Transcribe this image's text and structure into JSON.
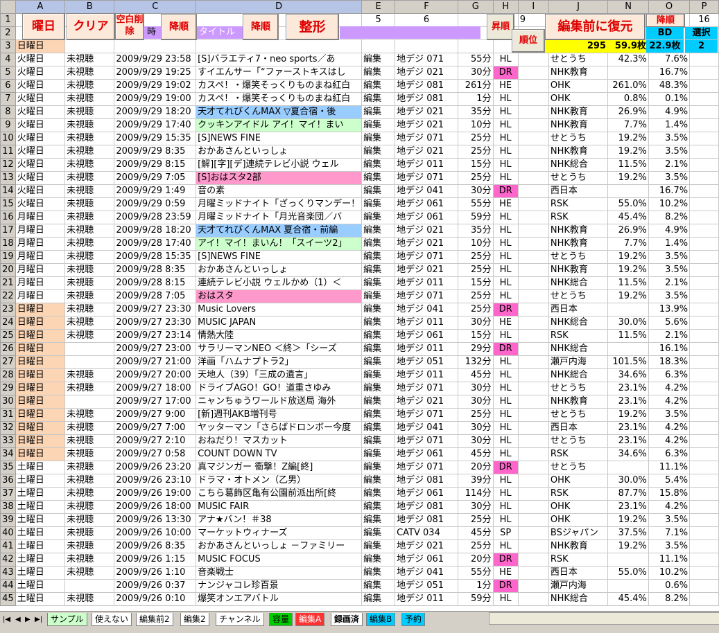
{
  "columns": [
    "A",
    "B",
    "C",
    "D",
    "E",
    "F",
    "G",
    "H",
    "I",
    "J",
    "N",
    "O",
    "P"
  ],
  "header_row1": {
    "e": "5",
    "f": "6",
    "i": "9",
    "p": "16"
  },
  "buttons": {
    "youbi": "曜日",
    "clear": "クリア",
    "blank_delete": "空白削除",
    "sort_desc_c": "降順",
    "sort_desc_d": "降順",
    "seikei": "整形",
    "shoujun": "昇順",
    "juni": "順位",
    "restore": "編集前に復元",
    "sort_desc_o": "降順"
  },
  "row2": {
    "c_label": "時",
    "d_label": "タイトル",
    "o_label": "BD",
    "p_label": "選択"
  },
  "row3": {
    "a": "日曜日",
    "n_total": "295",
    "n_pct": "59.9枚",
    "o_val": "22.9枚",
    "p_val": "2"
  },
  "rows": [
    {
      "n": "4",
      "a": "火曜日",
      "b": "未視聴",
      "c": "2009/9/29 23:58",
      "d": "[S]バラエティ7・neo sports／あ",
      "e": "編集",
      "f": "地デジ 071",
      "g": "55分",
      "h": "HL",
      "j": "せとうち",
      "n2": "42.3%",
      "o": "7.6%"
    },
    {
      "n": "5",
      "a": "火曜日",
      "b": "未視聴",
      "c": "2009/9/29 19:25",
      "d": "すイエんサー「“ファーストキスはし",
      "e": "編集",
      "f": "地デジ 021",
      "g": "30分",
      "h": "DR",
      "j": "NHK教育",
      "n2": "",
      "o": "16.7%"
    },
    {
      "n": "6",
      "a": "火曜日",
      "b": "未視聴",
      "c": "2009/9/29 19:02",
      "d": "カスペ！・爆笑そっくりものまね紅白",
      "e": "編集",
      "f": "地デジ 081",
      "g": "261分",
      "h": "HE",
      "j": "OHK",
      "n2": "261.0%",
      "o": "48.3%"
    },
    {
      "n": "7",
      "a": "火曜日",
      "b": "未視聴",
      "c": "2009/9/29 19:00",
      "d": "カスペ！・爆笑そっくりものまね紅白",
      "e": "編集",
      "f": "地デジ 081",
      "g": "1分",
      "h": "HL",
      "j": "OHK",
      "n2": "0.8%",
      "o": "0.1%"
    },
    {
      "n": "8",
      "a": "火曜日",
      "b": "未視聴",
      "c": "2009/9/29 18:20",
      "d": "天才てれびくんMAX ▽夏合宿・後",
      "e": "編集",
      "f": "地デジ 021",
      "g": "35分",
      "h": "HL",
      "j": "NHK教育",
      "n2": "26.9%",
      "o": "4.9%"
    },
    {
      "n": "9",
      "a": "火曜日",
      "b": "未視聴",
      "c": "2009/9/29 17:40",
      "d": "クッキンアイドル アイ！マイ！まい",
      "e": "編集",
      "f": "地デジ 021",
      "g": "10分",
      "h": "HL",
      "j": "NHK教育",
      "n2": "7.7%",
      "o": "1.4%"
    },
    {
      "n": "10",
      "a": "火曜日",
      "b": "未視聴",
      "c": "2009/9/29 15:35",
      "d": "[S]NEWS FINE",
      "e": "編集",
      "f": "地デジ 071",
      "g": "25分",
      "h": "HL",
      "j": "せとうち",
      "n2": "19.2%",
      "o": "3.5%"
    },
    {
      "n": "11",
      "a": "火曜日",
      "b": "未視聴",
      "c": "2009/9/29 8:35",
      "d": "おかあさんといっしょ",
      "e": "編集",
      "f": "地デジ 021",
      "g": "25分",
      "h": "HL",
      "j": "NHK教育",
      "n2": "19.2%",
      "o": "3.5%"
    },
    {
      "n": "12",
      "a": "火曜日",
      "b": "未視聴",
      "c": "2009/9/29 8:15",
      "d": "[解][字][デ]連続テレビ小説 ウェル",
      "e": "編集",
      "f": "地デジ 011",
      "g": "15分",
      "h": "HL",
      "j": "NHK総合",
      "n2": "11.5%",
      "o": "2.1%"
    },
    {
      "n": "13",
      "a": "火曜日",
      "b": "未視聴",
      "c": "2009/9/29 7:05",
      "d": "[S]おはスタ2部",
      "e": "編集",
      "f": "地デジ 071",
      "g": "25分",
      "h": "HL",
      "j": "せとうち",
      "n2": "19.2%",
      "o": "3.5%"
    },
    {
      "n": "14",
      "a": "火曜日",
      "b": "未視聴",
      "c": "2009/9/29 1:49",
      "d": "音の素",
      "e": "編集",
      "f": "地デジ 041",
      "g": "30分",
      "h": "DR",
      "j": "西日本",
      "n2": "",
      "o": "16.7%"
    },
    {
      "n": "15",
      "a": "火曜日",
      "b": "未視聴",
      "c": "2009/9/29 0:59",
      "d": "月曜ミッドナイト「ざっくりマンデー！",
      "e": "編集",
      "f": "地デジ 061",
      "g": "55分",
      "h": "HE",
      "j": "RSK",
      "n2": "55.0%",
      "o": "10.2%"
    },
    {
      "n": "16",
      "a": "月曜日",
      "b": "未視聴",
      "c": "2009/9/28 23:59",
      "d": "月曜ミッドナイト「月光音楽団／バ",
      "e": "編集",
      "f": "地デジ 061",
      "g": "59分",
      "h": "HL",
      "j": "RSK",
      "n2": "45.4%",
      "o": "8.2%"
    },
    {
      "n": "17",
      "a": "月曜日",
      "b": "未視聴",
      "c": "2009/9/28 18:20",
      "d": "天才てれびくんMAX 夏合宿・前編",
      "e": "編集",
      "f": "地デジ 021",
      "g": "35分",
      "h": "HL",
      "j": "NHK教育",
      "n2": "26.9%",
      "o": "4.9%"
    },
    {
      "n": "18",
      "a": "月曜日",
      "b": "未視聴",
      "c": "2009/9/28 17:40",
      "d": "アイ！マイ！まいん！「スイーツ2」",
      "e": "編集",
      "f": "地デジ 021",
      "g": "10分",
      "h": "HL",
      "j": "NHK教育",
      "n2": "7.7%",
      "o": "1.4%"
    },
    {
      "n": "19",
      "a": "月曜日",
      "b": "未視聴",
      "c": "2009/9/28 15:35",
      "d": "[S]NEWS FINE",
      "e": "編集",
      "f": "地デジ 071",
      "g": "25分",
      "h": "HL",
      "j": "せとうち",
      "n2": "19.2%",
      "o": "3.5%"
    },
    {
      "n": "20",
      "a": "月曜日",
      "b": "未視聴",
      "c": "2009/9/28 8:35",
      "d": "おかあさんといっしょ",
      "e": "編集",
      "f": "地デジ 021",
      "g": "25分",
      "h": "HL",
      "j": "NHK教育",
      "n2": "19.2%",
      "o": "3.5%"
    },
    {
      "n": "21",
      "a": "月曜日",
      "b": "未視聴",
      "c": "2009/9/28 8:15",
      "d": "連続テレビ小説 ウェルかめ（1）＜",
      "e": "編集",
      "f": "地デジ 011",
      "g": "15分",
      "h": "HL",
      "j": "NHK総合",
      "n2": "11.5%",
      "o": "2.1%"
    },
    {
      "n": "22",
      "a": "月曜日",
      "b": "未視聴",
      "c": "2009/9/28 7:05",
      "d": "おはスタ",
      "e": "編集",
      "f": "地デジ 071",
      "g": "25分",
      "h": "HL",
      "j": "せとうち",
      "n2": "19.2%",
      "o": "3.5%"
    },
    {
      "n": "23",
      "a": "日曜日",
      "b": "未視聴",
      "c": "2009/9/27 23:30",
      "d": "Music Lovers",
      "e": "編集",
      "f": "地デジ 041",
      "g": "25分",
      "h": "DR",
      "j": "西日本",
      "n2": "",
      "o": "13.9%"
    },
    {
      "n": "24",
      "a": "日曜日",
      "b": "未視聴",
      "c": "2009/9/27 23:30",
      "d": "MUSIC JAPAN",
      "e": "編集",
      "f": "地デジ 011",
      "g": "30分",
      "h": "HE",
      "j": "NHK総合",
      "n2": "30.0%",
      "o": "5.6%"
    },
    {
      "n": "25",
      "a": "日曜日",
      "b": "未視聴",
      "c": "2009/9/27 23:14",
      "d": "情熱大陸",
      "e": "編集",
      "f": "地デジ 061",
      "g": "15分",
      "h": "HL",
      "j": "RSK",
      "n2": "11.5%",
      "o": "2.1%"
    },
    {
      "n": "26",
      "a": "日曜日",
      "b": "",
      "c": "2009/9/27 23:00",
      "d": "サラリーマンNEO ＜終＞「シーズ",
      "e": "編集",
      "f": "地デジ 011",
      "g": "29分",
      "h": "DR",
      "j": "NHK総合",
      "n2": "",
      "o": "16.1%"
    },
    {
      "n": "27",
      "a": "日曜日",
      "b": "",
      "c": "2009/9/27 21:00",
      "d": "洋画「ハムナプトラ2」",
      "e": "編集",
      "f": "地デジ 051",
      "g": "132分",
      "h": "HL",
      "j": "瀬戸内海",
      "n2": "101.5%",
      "o": "18.3%"
    },
    {
      "n": "28",
      "a": "日曜日",
      "b": "未視聴",
      "c": "2009/9/27 20:00",
      "d": "天地人（39）「三成の遺言」",
      "e": "編集",
      "f": "地デジ 011",
      "g": "45分",
      "h": "HL",
      "j": "NHK総合",
      "n2": "34.6%",
      "o": "6.3%"
    },
    {
      "n": "29",
      "a": "日曜日",
      "b": "未視聴",
      "c": "2009/9/27 18:00",
      "d": "ドライブAGO！GO！道重さゆみ",
      "e": "編集",
      "f": "地デジ 071",
      "g": "30分",
      "h": "HL",
      "j": "せとうち",
      "n2": "23.1%",
      "o": "4.2%"
    },
    {
      "n": "30",
      "a": "日曜日",
      "b": "",
      "c": "2009/9/27 17:00",
      "d": "ニャンちゅうワールド放送局 海外",
      "e": "編集",
      "f": "地デジ 021",
      "g": "30分",
      "h": "HL",
      "j": "NHK教育",
      "n2": "23.1%",
      "o": "4.2%"
    },
    {
      "n": "31",
      "a": "日曜日",
      "b": "未視聴",
      "c": "2009/9/27 9:00",
      "d": "[新]週刊AKB増刊号",
      "e": "編集",
      "f": "地デジ 071",
      "g": "25分",
      "h": "HL",
      "j": "せとうち",
      "n2": "19.2%",
      "o": "3.5%"
    },
    {
      "n": "32",
      "a": "日曜日",
      "b": "未視聴",
      "c": "2009/9/27 7:00",
      "d": "ヤッターマン「さらばドロンボー今度",
      "e": "編集",
      "f": "地デジ 041",
      "g": "30分",
      "h": "HL",
      "j": "西日本",
      "n2": "23.1%",
      "o": "4.2%"
    },
    {
      "n": "33",
      "a": "日曜日",
      "b": "未視聴",
      "c": "2009/9/27 2:10",
      "d": "おねだり！マスカット",
      "e": "編集",
      "f": "地デジ 071",
      "g": "30分",
      "h": "HL",
      "j": "せとうち",
      "n2": "23.1%",
      "o": "4.2%"
    },
    {
      "n": "34",
      "a": "日曜日",
      "b": "未視聴",
      "c": "2009/9/27 0:58",
      "d": "COUNT DOWN TV",
      "e": "編集",
      "f": "地デジ 061",
      "g": "45分",
      "h": "HL",
      "j": "RSK",
      "n2": "34.6%",
      "o": "6.3%"
    },
    {
      "n": "35",
      "a": "土曜日",
      "b": "未視聴",
      "c": "2009/9/26 23:20",
      "d": "真マジンガー 衝撃！Z編[終]",
      "e": "編集",
      "f": "地デジ 071",
      "g": "20分",
      "h": "DR",
      "j": "せとうち",
      "n2": "",
      "o": "11.1%"
    },
    {
      "n": "36",
      "a": "土曜日",
      "b": "未視聴",
      "c": "2009/9/26 23:10",
      "d": "ドラマ・オトメン（乙男）",
      "e": "編集",
      "f": "地デジ 081",
      "g": "39分",
      "h": "HL",
      "j": "OHK",
      "n2": "30.0%",
      "o": "5.4%"
    },
    {
      "n": "37",
      "a": "土曜日",
      "b": "未視聴",
      "c": "2009/9/26 19:00",
      "d": "こちら葛飾区亀有公園前派出所[終",
      "e": "編集",
      "f": "地デジ 061",
      "g": "114分",
      "h": "HL",
      "j": "RSK",
      "n2": "87.7%",
      "o": "15.8%"
    },
    {
      "n": "38",
      "a": "土曜日",
      "b": "未視聴",
      "c": "2009/9/26 18:00",
      "d": "MUSIC FAIR",
      "e": "編集",
      "f": "地デジ 081",
      "g": "30分",
      "h": "HL",
      "j": "OHK",
      "n2": "23.1%",
      "o": "4.2%"
    },
    {
      "n": "39",
      "a": "土曜日",
      "b": "未視聴",
      "c": "2009/9/26 13:30",
      "d": "アナ★バン！＃38",
      "e": "編集",
      "f": "地デジ 081",
      "g": "25分",
      "h": "HL",
      "j": "OHK",
      "n2": "19.2%",
      "o": "3.5%"
    },
    {
      "n": "40",
      "a": "土曜日",
      "b": "未視聴",
      "c": "2009/9/26 10:00",
      "d": "マーケットウィナーズ",
      "e": "編集",
      "f": "CATV 034",
      "g": "45分",
      "h": "SP",
      "j": "BSジャパン",
      "n2": "37.5%",
      "o": "7.1%"
    },
    {
      "n": "41",
      "a": "土曜日",
      "b": "未視聴",
      "c": "2009/9/26 8:35",
      "d": "おかあさんといっしょ －ファミリー",
      "e": "編集",
      "f": "地デジ 021",
      "g": "25分",
      "h": "HL",
      "j": "NHK教育",
      "n2": "19.2%",
      "o": "3.5%"
    },
    {
      "n": "42",
      "a": "土曜日",
      "b": "未視聴",
      "c": "2009/9/26 1:15",
      "d": "MUSIC FOCUS",
      "e": "編集",
      "f": "地デジ 061",
      "g": "20分",
      "h": "DR",
      "j": "RSK",
      "n2": "",
      "o": "11.1%"
    },
    {
      "n": "43",
      "a": "土曜日",
      "b": "未視聴",
      "c": "2009/9/26 1:10",
      "d": "音楽戦士",
      "e": "編集",
      "f": "地デジ 041",
      "g": "55分",
      "h": "HE",
      "j": "西日本",
      "n2": "55.0%",
      "o": "10.2%"
    },
    {
      "n": "44",
      "a": "土曜日",
      "b": "",
      "c": "2009/9/26 0:37",
      "d": "ナンジャコレ珍百景",
      "e": "編集",
      "f": "地デジ 051",
      "g": "1分",
      "h": "DR",
      "j": "瀬戸内海",
      "n2": "",
      "o": "0.6%"
    },
    {
      "n": "45",
      "a": "土曜日",
      "b": "未視聴",
      "c": "2009/9/26 0:10",
      "d": "爆笑オンエアバトル",
      "e": "編集",
      "f": "地デジ 011",
      "g": "59分",
      "h": "HL",
      "j": "NHK総合",
      "n2": "45.4%",
      "o": "8.2%"
    }
  ],
  "tabs": [
    "サンプル",
    "使えない",
    "編集前2",
    "編集2",
    "チャンネル",
    "容量",
    "編集A",
    "録画済",
    "編集B",
    "予約"
  ],
  "colors": {
    "orange": "#fcd5b4",
    "magenta": "#ff66cc",
    "lavender": "#cc99ff",
    "yellow": "#ffff00",
    "cyan": "#00ccff",
    "blue_title": "#99ccff",
    "green_title": "#ccffcc",
    "pink_title": "#ff99cc"
  }
}
